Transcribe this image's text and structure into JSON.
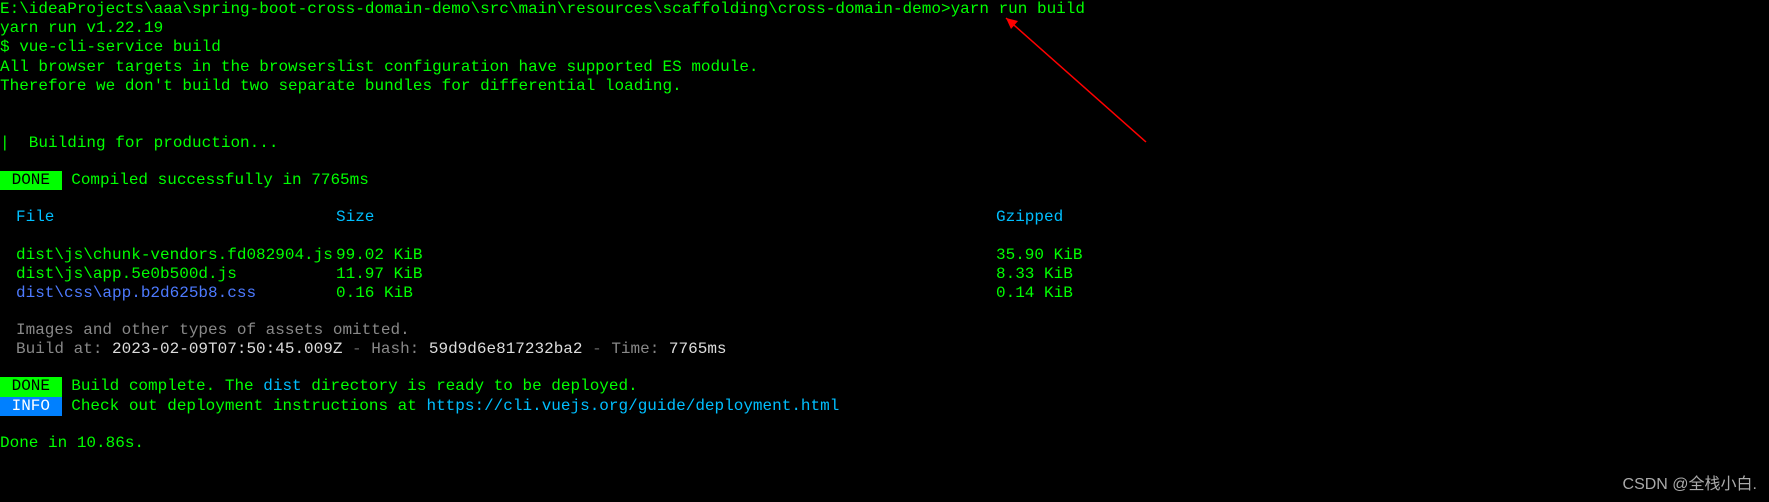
{
  "prompt": {
    "path": "E:\\ideaProjects\\aaa\\spring-boot-cross-domain-demo\\src\\main\\resources\\scaffolding\\cross-domain-demo>",
    "command": "yarn run build"
  },
  "yarn_version": "yarn run v1.22.19",
  "vue_command": "$ vue-cli-service build",
  "browser_msg1": "All browser targets in the browserslist configuration have supported ES module.",
  "browser_msg2": "Therefore we don't build two separate bundles for differential loading.",
  "building_msg": "|  Building for production...",
  "done_badge": " DONE ",
  "compiled_msg": " Compiled successfully in 7765ms",
  "table": {
    "header": {
      "file": "File",
      "size": "Size",
      "gzip": "Gzipped"
    },
    "rows": [
      {
        "file": "dist\\js\\chunk-vendors.fd082904.js",
        "size": "99.02 KiB",
        "gzip": "35.90 KiB",
        "type": "js"
      },
      {
        "file": "dist\\js\\app.5e0b500d.js",
        "size": "11.97 KiB",
        "gzip": "8.33 KiB",
        "type": "js"
      },
      {
        "file": "dist\\css\\app.b2d625b8.css",
        "size": "0.16 KiB",
        "gzip": "0.14 KiB",
        "type": "css"
      }
    ]
  },
  "omitted_msg": "Images and other types of assets omitted.",
  "build_at": {
    "prefix": "Build at: ",
    "time": "2023-02-09T07:50:45.009Z",
    "hash_label": "Hash: ",
    "hash": "59d9d6e817232ba2",
    "time_label": "Time: ",
    "time_val": "7765ms",
    "sep": " - "
  },
  "build_complete": {
    "prefix": " Build complete. The ",
    "dist": "dist",
    "suffix": " directory is ready to be deployed."
  },
  "info_badge": " INFO ",
  "deploy_info": {
    "prefix": " Check out deployment instructions at ",
    "url": "https://cli.vuejs.org/guide/deployment.html"
  },
  "done_in": "Done in 10.86s.",
  "watermark": "CSDN @全栈小白."
}
